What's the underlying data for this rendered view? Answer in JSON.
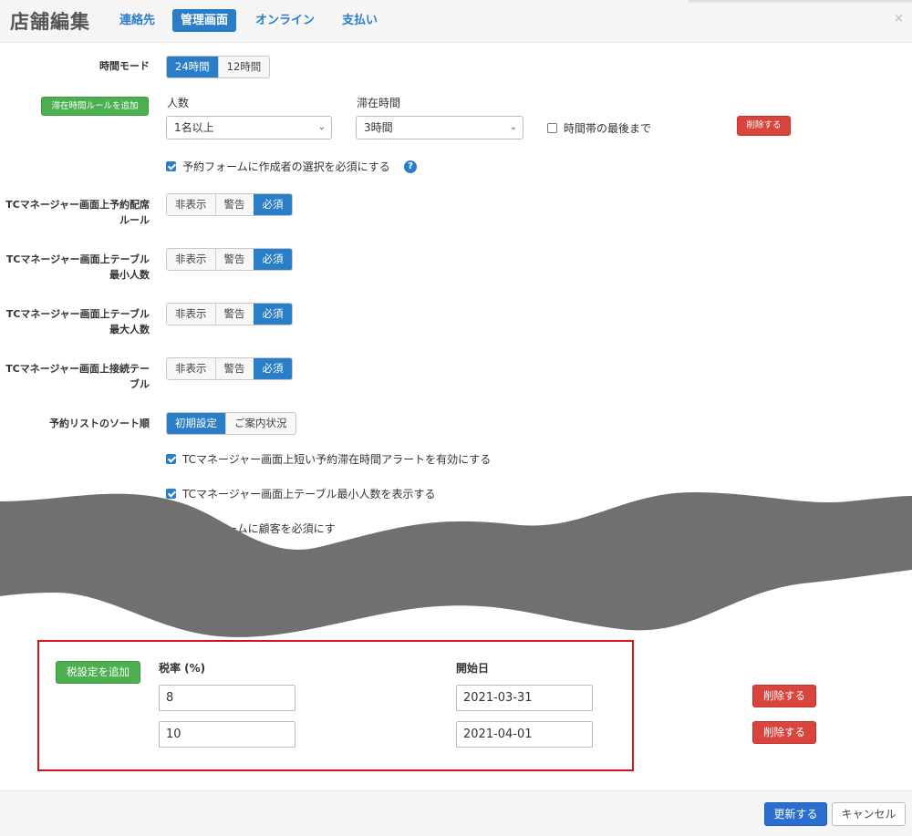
{
  "header": {
    "title": "店舗編集",
    "tabs": [
      "連絡先",
      "管理画面",
      "オンライン",
      "支払い"
    ],
    "active_tab": "管理画面",
    "close": "×"
  },
  "time_mode": {
    "label": "時間モード",
    "options": [
      "24時間",
      "12時間"
    ],
    "selected": "24時間"
  },
  "stay_rule": {
    "add_button": "滞在時間ルールを追加",
    "people_label": "人数",
    "people_value": "1名以上",
    "stay_label": "滞在時間",
    "stay_value": "3時間",
    "until_end_label": "時間帯の最後まで",
    "until_end_checked": false,
    "delete_button": "削除する"
  },
  "require_creator": {
    "label": "予約フォームに作成者の選択を必須にする",
    "checked": true,
    "help_icon": "question-circle-icon"
  },
  "segment_rows": [
    {
      "label": "TCマネージャー画面上予約配席ルール",
      "options": [
        "非表示",
        "警告",
        "必須"
      ],
      "selected": "必須"
    },
    {
      "label": "TCマネージャー画面上テーブル最小人数",
      "options": [
        "非表示",
        "警告",
        "必須"
      ],
      "selected": "必須"
    },
    {
      "label": "TCマネージャー画面上テーブル最大人数",
      "options": [
        "非表示",
        "警告",
        "必須"
      ],
      "selected": "必須"
    },
    {
      "label": "TCマネージャー画面上接続テーブル",
      "options": [
        "非表示",
        "警告",
        "必須"
      ],
      "selected": "必須"
    }
  ],
  "sort": {
    "label": "予約リストのソート順",
    "options": [
      "初期設定",
      "ご案内状況"
    ],
    "selected": "初期設定"
  },
  "checkboxes": [
    {
      "label": "TCマネージャー画面上短い予約滞在時間アラートを有効にする",
      "checked": true
    },
    {
      "label": "TCマネージャー画面上テーブル最小人数を表示する",
      "checked": true
    },
    {
      "label": "予約フォームに顧客を必須にす",
      "checked": true
    }
  ],
  "tax": {
    "add_button": "税設定を追加",
    "rate_header": "税率 (%)",
    "start_header": "開始日",
    "rows": [
      {
        "rate": "8",
        "start": "2021-03-31",
        "delete": "削除する"
      },
      {
        "rate": "10",
        "start": "2021-04-01",
        "delete": "削除する"
      }
    ]
  },
  "footer": {
    "update": "更新する",
    "cancel": "キャンセル"
  },
  "colors": {
    "accent": "#2a7ec8",
    "add_green": "#4caf50",
    "delete_red": "#d9443d",
    "highlight": "#d9101d",
    "wave": "#707070"
  }
}
